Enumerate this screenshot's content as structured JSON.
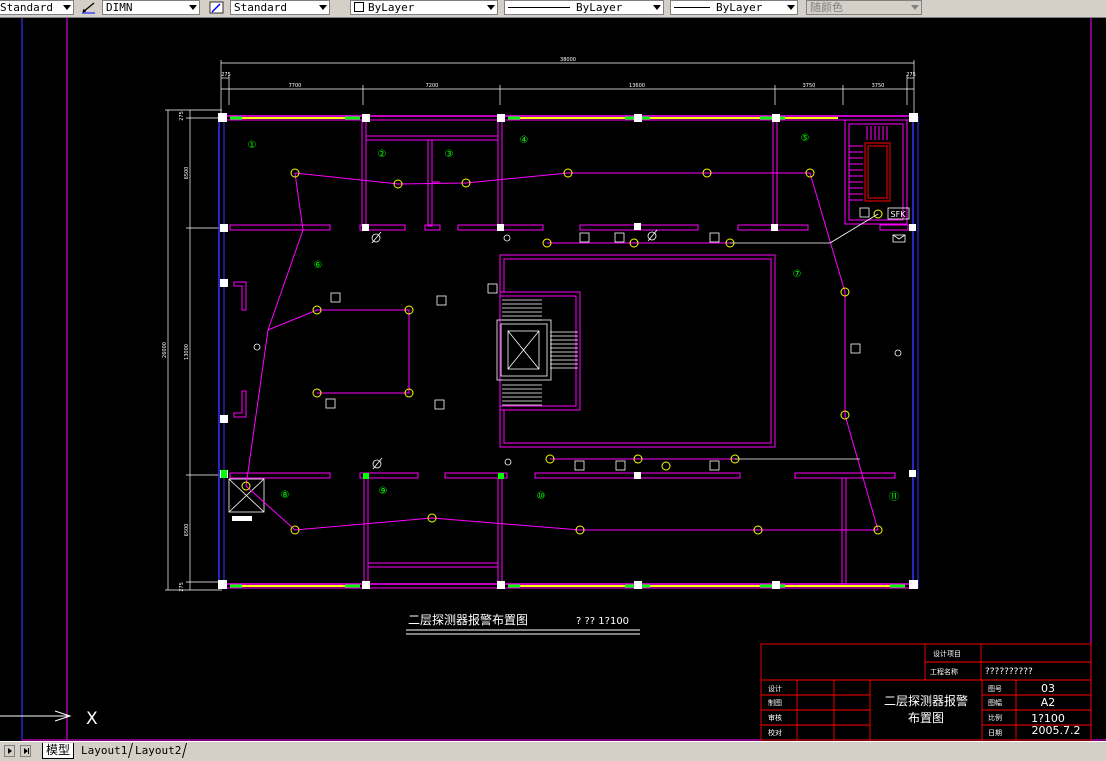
{
  "toolbar": {
    "text_style": "Standard",
    "dim_style": "DIMN",
    "table_style": "Standard",
    "layer": "ByLayer",
    "linetype": "ByLayer",
    "lineweight": "ByLayer",
    "plot_style": "随颜色"
  },
  "tabs": {
    "model": "模型",
    "layout1": "Layout1",
    "layout2": "Layout2"
  },
  "drawing": {
    "dims_top": {
      "total": "38000",
      "seg1": "7700",
      "seg2": "7200",
      "seg3": "13600",
      "seg4": "3750",
      "seg5": "3750",
      "left_small": "275",
      "right_small": "275"
    },
    "dims_left": {
      "total": "26000",
      "seg1": "6500",
      "seg2": "13000",
      "seg3": "6500",
      "top_small": "275",
      "bottom_small": "275"
    },
    "room_numbers": [
      "①",
      "②",
      "③",
      "④",
      "⑤",
      "⑥",
      "⑦",
      "⑧",
      "⑨",
      "⑩",
      "⑪"
    ],
    "sfk_label": "SFK",
    "drawing_title": "二层探测器报警布置图",
    "scale_text": "? ?? 1?100"
  },
  "title_block": {
    "design_project_label": "设计项目",
    "project_name_label": "工程名称",
    "project_name_value": "??????????",
    "design_label": "设计",
    "draw_label": "制图",
    "review_label": "审核",
    "check_label": "校对",
    "center_title_1": "二层探测器报警",
    "center_title_2": "布置图",
    "drawing_no_label": "图号",
    "drawing_no_value": "03",
    "size_label": "图幅",
    "size_value": "A2",
    "scale_label": "比例",
    "scale_value": "1?100",
    "date_label": "日期",
    "date_value": "2005.7.2"
  },
  "ucs": {
    "x_label": "X"
  },
  "colors": {
    "magenta": "#ff00ff",
    "yellow": "#ffff00",
    "green": "#00ff00",
    "blue": "#3333ff",
    "red": "#ff0000",
    "white": "#ffffff"
  }
}
